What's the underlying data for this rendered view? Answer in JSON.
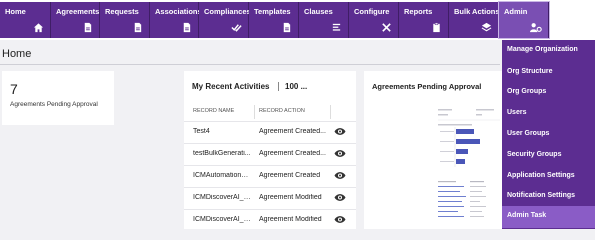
{
  "nav": {
    "tiles": [
      {
        "label": "Home",
        "icon": "home-icon"
      },
      {
        "label": "Agreements",
        "icon": "document-icon"
      },
      {
        "label": "Requests",
        "icon": "document-icon"
      },
      {
        "label": "Associations",
        "icon": "document-icon"
      },
      {
        "label": "Compliances",
        "icon": "checkmarks-icon"
      },
      {
        "label": "Templates",
        "icon": "document-icon"
      },
      {
        "label": "Clauses",
        "icon": "list-icon"
      },
      {
        "label": "Configure",
        "icon": "tools-icon"
      },
      {
        "label": "Reports",
        "icon": "clipboard-icon"
      },
      {
        "label": "Bulk Actions",
        "icon": "layers-icon"
      },
      {
        "label": "Admin",
        "icon": "users-gear-icon"
      }
    ]
  },
  "page": {
    "title": "Home"
  },
  "kpi": {
    "value": "7",
    "label": "Agreements Pending Approval"
  },
  "recent": {
    "title": "My Recent Activities",
    "count": "100 ...",
    "columns": [
      "RECORD NAME",
      "RECORD ACTION"
    ],
    "rows": [
      {
        "name": "Test4",
        "action": "Agreement Created..."
      },
      {
        "name": "testBulkGenerati...",
        "action": "Agreement Created..."
      },
      {
        "name": "ICMAutomationN...",
        "action": "Agreement Created"
      },
      {
        "name": "ICMDiscoverAI_CT",
        "action": "Agreement Modified"
      },
      {
        "name": "ICMDiscoverAI_CT",
        "action": "Agreement Modified"
      }
    ]
  },
  "pending": {
    "title": "Agreements Pending Approval"
  },
  "admin_menu": {
    "items": [
      "Manage Organization",
      "Org Structure",
      "Org Groups",
      "Users",
      "User Groups",
      "Security Groups",
      "Application Settings",
      "Notification Settings",
      "Admin Task"
    ],
    "active_index": 8
  },
  "colors": {
    "nav_purple": "#5c2d91",
    "active_purple": "#8a5cc6"
  }
}
